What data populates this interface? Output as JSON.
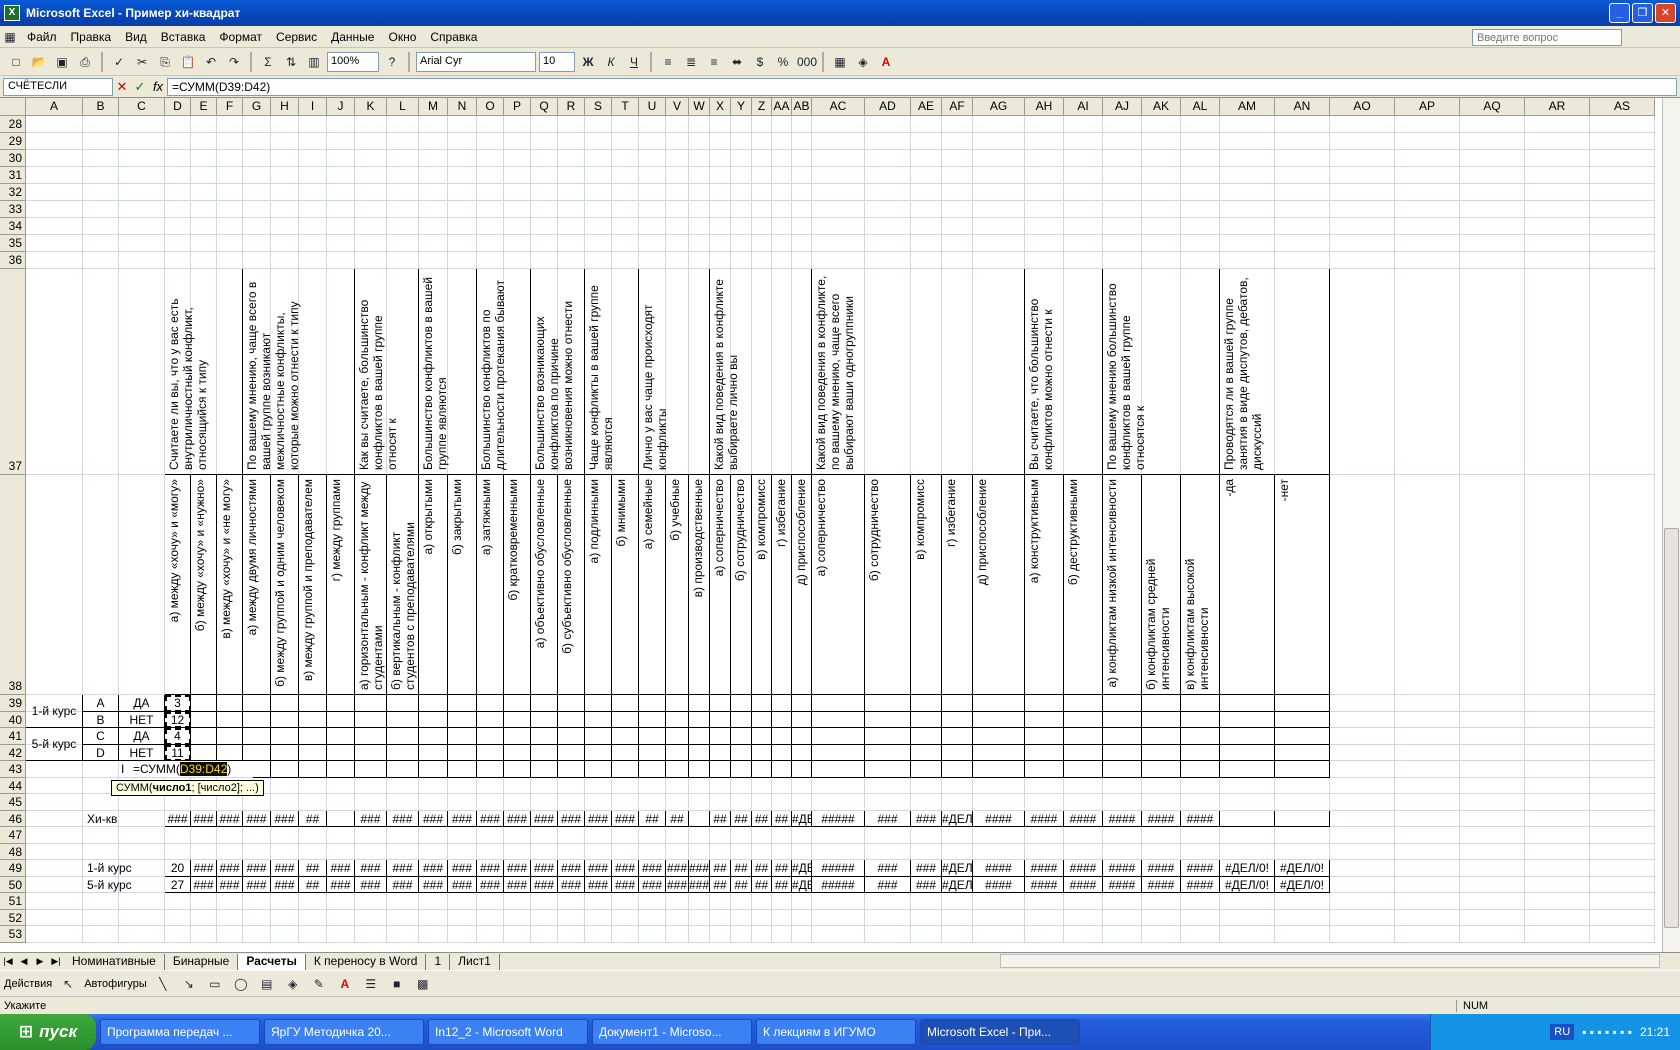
{
  "window": {
    "title": "Microsoft Excel - Пример хи-квадрат"
  },
  "menu": [
    "Файл",
    "Правка",
    "Вид",
    "Вставка",
    "Формат",
    "Сервис",
    "Данные",
    "Окно",
    "Справка"
  ],
  "question_box": "Введите вопрос",
  "toolbar": {
    "zoom": "100%",
    "font": "Arial Cyr",
    "size": "10"
  },
  "formula": {
    "namebox": "СЧЁТЕСЛИ",
    "text": "=СУММ(D39:D42)"
  },
  "columns": [
    "A",
    "B",
    "C",
    "D",
    "E",
    "F",
    "G",
    "H",
    "I",
    "J",
    "K",
    "L",
    "M",
    "N",
    "O",
    "P",
    "Q",
    "R",
    "S",
    "T",
    "U",
    "V",
    "W",
    "X",
    "Y",
    "Z",
    "AA",
    "AB",
    "AC",
    "AD",
    "AE",
    "AF",
    "AG",
    "AH",
    "AI",
    "AJ",
    "AK",
    "AL",
    "AM",
    "AN",
    "AO",
    "AP",
    "AQ",
    "AR",
    "AS"
  ],
  "rows_top": [
    "28",
    "29",
    "30",
    "31",
    "32",
    "33",
    "34",
    "35",
    "36"
  ],
  "rows_bottom": [
    "39",
    "40",
    "41",
    "42",
    "43",
    "44",
    "45",
    "46",
    "47",
    "48",
    "49",
    "50",
    "51",
    "52",
    "53"
  ],
  "row37": "37",
  "row38": "38",
  "questions": [
    "Считаете ли вы, что у вас есть внутриличностный конфликт, относящийся к типу",
    "По вашему мнению, чаще всего в вашей группе возникают межличностные конфликты, которые можно отнести к типу",
    "Как вы считаете, большинство конфликтов в вашей группе относят к",
    "Большинство конфликтов в вашей группе являются",
    "Большинство конфликтов по длительности протекания бывают",
    "Большинство возникающих конфликтов по причине возникновения можно отнести",
    "Чаще конфликты в вашей группе являются",
    "Лично у вас чаще происходят конфликты",
    "Какой вид поведения в конфликте выбираете лично вы",
    "Какой вид поведения в конфликте, по вашему мнению, чаще всего выбирают ваши одногруппники",
    "Вы считаете, что большинство конфликтов можно отнести к",
    "По вашему мнению большинство конфликтов в вашей группе относятся к",
    "Проводятся ли в вашей группе занятия в виде диспутов, дебатов, дискуссий"
  ],
  "answers": [
    "а) между «хочу» и «могу»",
    "б) между «хочу» и «нужно»",
    "в) между «хочу» и «не могу»",
    "а) между двумя личностями",
    "б) между группой и одним человеком",
    "в) между группой и преподавателем",
    "г) между группами",
    "а) горизонтальным - конфликт между студентами",
    "б) вертикальным - конфликт студентов с преподавателями",
    "а) открытыми",
    "б) закрытыми",
    "а) затяжными",
    "б) кратковременными",
    "а) объективно обусловленные",
    "б) субъективно обусловленные",
    "а) подлинными",
    "б) мнимыми",
    "а) семейные",
    "б) учебные",
    "в) производственные",
    "а) соперничество",
    "б) сотрудничество",
    "в) компромисс",
    "г) избегание",
    "д) приспособление",
    "а) соперничество",
    "б) сотрудничество",
    "в) компромисс",
    "г) избегание",
    "д) приспособление",
    "а) конструктивным",
    "б) деструктивными",
    "а) конфликтам низкой интенсивности",
    "б) конфликтам средней интенсивности",
    "в) конфликтам высокой интенсивности",
    "-да",
    "-нет"
  ],
  "data_rows": {
    "r39": {
      "a": "1-й курс",
      "b": "A",
      "c": "ДА",
      "d": "3"
    },
    "r40": {
      "b": "B",
      "c": "НЕТ",
      "d": "12"
    },
    "r41": {
      "a": "5-й курс",
      "b": "C",
      "c": "ДА",
      "d": "4"
    },
    "r42": {
      "b": "D",
      "c": "НЕТ",
      "d": "11"
    },
    "r43": {
      "c": "I",
      "formula": "=СУММ(",
      "ref": "D39:D42",
      "close": ")"
    },
    "r46": {
      "label": "Хи-кв"
    },
    "r49": {
      "label": "1-й курс",
      "d": "20"
    },
    "r50": {
      "label": "5-й курс",
      "d": "27"
    }
  },
  "hash_short": "###",
  "hash_med": "####",
  "hash_long": "#####",
  "hash_tiny": "##",
  "err_div": "#ДЕЛ/0!",
  "tooltip": {
    "fn": "СУММ(",
    "arg1": "число1",
    "rest": "; [число2]; ...)"
  },
  "tabs": [
    "Номинативные",
    "Бинарные",
    "Расчеты",
    "К переносу в Word",
    "1",
    "Лист1"
  ],
  "drawbar": {
    "actions": "Действия",
    "autoshapes": "Автофигуры"
  },
  "status": {
    "left": "Укажите",
    "num": "NUM"
  },
  "taskbar": {
    "start": "пуск",
    "tasks": [
      "Программа передач ...",
      "ЯрГУ Методичка 20...",
      "In12_2 - Microsoft Word",
      "Документ1 - Microso...",
      "К лекциям в ИГУМО",
      "Microsoft Excel - При..."
    ],
    "lang": "RU",
    "clock": "21:21"
  }
}
